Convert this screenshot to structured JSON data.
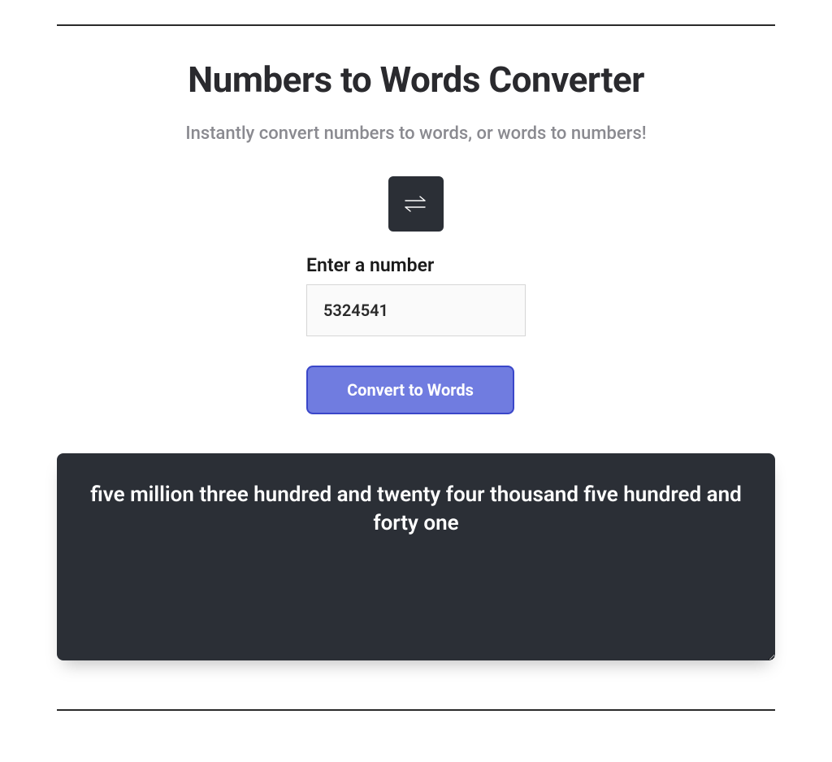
{
  "title": "Numbers to Words Converter",
  "subtitle": "Instantly convert numbers to words, or words to numbers!",
  "form": {
    "label": "Enter a number",
    "value": "5324541",
    "convert_label": "Convert to Words"
  },
  "output": "five million three hundred and twenty four thousand five hundred and forty one"
}
